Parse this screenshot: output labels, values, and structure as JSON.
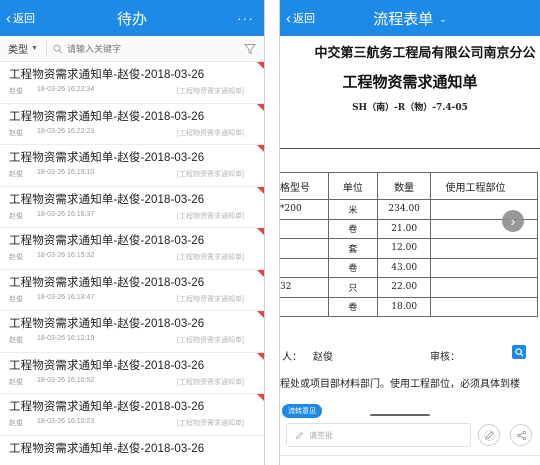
{
  "left": {
    "header": {
      "back_label": "返回",
      "title": "待办",
      "more": "···"
    },
    "filter": {
      "type_label": "类型",
      "search_placeholder": "请输入关键字"
    },
    "items": [
      {
        "title": "工程物资需求通知单-赵俊-2018-03-26",
        "person": "赵俊",
        "time": "18-03-26 16:22:34",
        "tag": "[工程物资需求通知单]"
      },
      {
        "title": "工程物资需求通知单-赵俊-2018-03-26",
        "person": "赵俊",
        "time": "18-03-26 16:22:23",
        "tag": "[工程物资需求通知单]"
      },
      {
        "title": "工程物资需求通知单-赵俊-2018-03-26",
        "person": "赵俊",
        "time": "18-03-26 16:19:10",
        "tag": "[工程物资需求通知单]"
      },
      {
        "title": "工程物资需求通知单-赵俊-2018-03-26",
        "person": "赵俊",
        "time": "18-03-26 16:16:37",
        "tag": "[工程物资需求通知单]"
      },
      {
        "title": "工程物资需求通知单-赵俊-2018-03-26",
        "person": "赵俊",
        "time": "18-03-26 16:15:32",
        "tag": "[工程物资需求通知单]"
      },
      {
        "title": "工程物资需求通知单-赵俊-2018-03-26",
        "person": "赵俊",
        "time": "18-03-26 16:13:47",
        "tag": "[工程物资需求通知单]"
      },
      {
        "title": "工程物资需求通知单-赵俊-2018-03-26",
        "person": "赵俊",
        "time": "18-03-26 16:12:19",
        "tag": "[工程物资需求通知单]"
      },
      {
        "title": "工程物资需求通知单-赵俊-2018-03-26",
        "person": "赵俊",
        "time": "18-03-26 16:10:52",
        "tag": "[工程物资需求通知单]"
      },
      {
        "title": "工程物资需求通知单-赵俊-2018-03-26",
        "person": "赵俊",
        "time": "18-03-26 16:10:23",
        "tag": "[工程物资需求通知单]"
      },
      {
        "title": "工程物资需求通知单-赵俊-2018-03-26",
        "person": "",
        "time": "",
        "tag": ""
      }
    ]
  },
  "right": {
    "header": {
      "back_label": "返回",
      "title": "流程表单"
    },
    "document": {
      "company": "中交第三航务工程局有限公司南京分公",
      "title": "工程物资需求通知单",
      "code": "SH（南）-R（物）-7.4-05",
      "table_headers": [
        "格型号",
        "单位",
        "数量",
        "使用工程部位"
      ],
      "rows": [
        [
          "*200",
          "米",
          "234.00",
          ""
        ],
        [
          "",
          "卷",
          "21.00",
          ""
        ],
        [
          "",
          "套",
          "12.00",
          ""
        ],
        [
          "",
          "卷",
          "43.00",
          ""
        ],
        [
          "32",
          "只",
          "22.00",
          ""
        ],
        [
          "",
          "卷",
          "18.00",
          ""
        ]
      ],
      "sign_colon": "人：",
      "signer": "赵俊",
      "audit_label": "审核：",
      "note": "程处或项目部材料部门。使用工程部位，必须具体到楼"
    },
    "flow_badge": "流转意见",
    "comment_placeholder": "请签批"
  },
  "colors": {
    "accent": "#1e8ae8",
    "flag": "#e0454a"
  }
}
